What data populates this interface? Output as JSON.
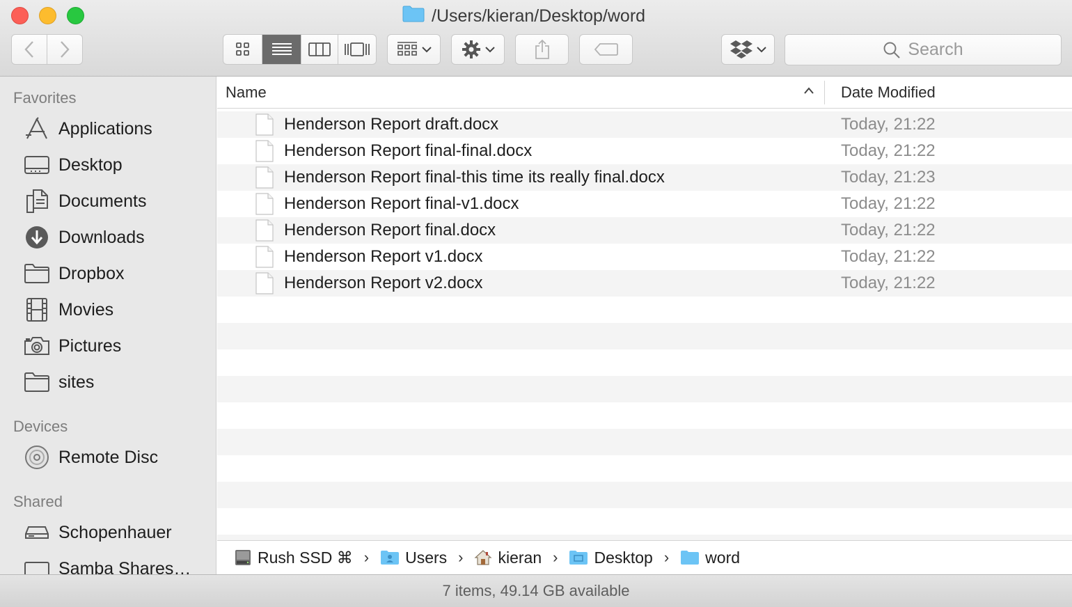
{
  "window": {
    "title": "/Users/kieran/Desktop/word"
  },
  "toolbar": {
    "back_icon": "chevron-left-icon",
    "forward_icon": "chevron-right-icon",
    "view_modes": [
      "icon-view",
      "list-view",
      "column-view",
      "cover-flow-view"
    ],
    "active_view": "list-view",
    "search_placeholder": "Search"
  },
  "sidebar": {
    "favorites_label": "Favorites",
    "favorites": [
      {
        "label": "Applications",
        "icon": "applications-icon"
      },
      {
        "label": "Desktop",
        "icon": "desktop-icon"
      },
      {
        "label": "Documents",
        "icon": "documents-icon"
      },
      {
        "label": "Downloads",
        "icon": "downloads-icon"
      },
      {
        "label": "Dropbox",
        "icon": "folder-icon"
      },
      {
        "label": "Movies",
        "icon": "movies-icon"
      },
      {
        "label": "Pictures",
        "icon": "camera-icon"
      },
      {
        "label": "sites",
        "icon": "folder-icon"
      }
    ],
    "devices_label": "Devices",
    "devices": [
      {
        "label": "Remote Disc",
        "icon": "disc-icon"
      }
    ],
    "shared_label": "Shared",
    "shared": [
      {
        "label": "Schopenhauer",
        "icon": "server-icon"
      },
      {
        "label": "Samba Shares…",
        "icon": "display-icon"
      }
    ]
  },
  "list": {
    "columns": {
      "name": "Name",
      "date_modified": "Date Modified"
    },
    "files": [
      {
        "name": "Henderson Report draft.docx",
        "modified": "Today, 21:22"
      },
      {
        "name": "Henderson Report final-final.docx",
        "modified": "Today, 21:22"
      },
      {
        "name": "Henderson Report final-this time its really final.docx",
        "modified": "Today, 21:23"
      },
      {
        "name": "Henderson Report final-v1.docx",
        "modified": "Today, 21:22"
      },
      {
        "name": "Henderson Report final.docx",
        "modified": "Today, 21:22"
      },
      {
        "name": "Henderson Report v1.docx",
        "modified": "Today, 21:22"
      },
      {
        "name": "Henderson Report v2.docx",
        "modified": "Today, 21:22"
      }
    ]
  },
  "pathbar": {
    "crumbs": [
      "Rush SSD ⌘",
      "Users",
      "kieran",
      "Desktop",
      "word"
    ]
  },
  "status": {
    "text": "7 items, 49.14 GB available"
  },
  "colors": {
    "folder_blue": "#6cc4f5",
    "close": "#fc5f57",
    "minimize": "#fdbc2e",
    "maximize": "#28c840"
  }
}
